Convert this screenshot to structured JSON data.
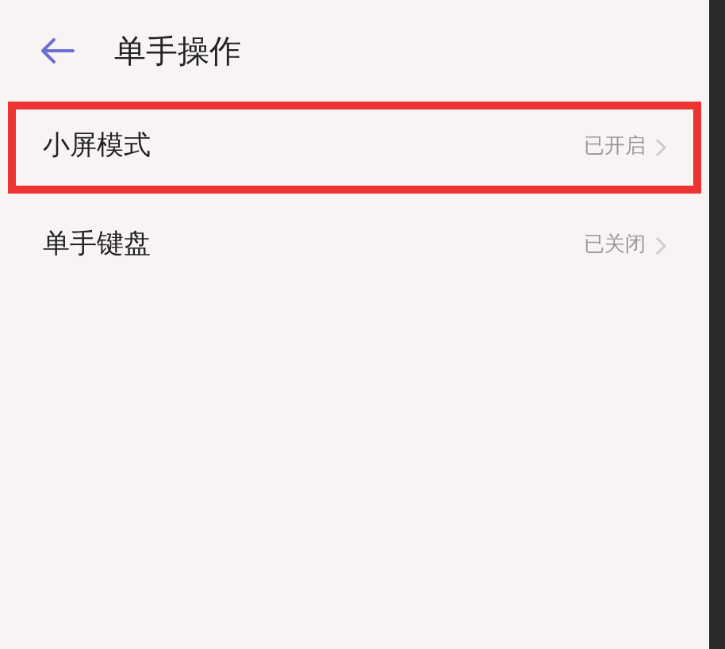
{
  "header": {
    "title": "单手操作"
  },
  "items": [
    {
      "label": "小屏模式",
      "value": "已开启",
      "highlighted": true
    },
    {
      "label": "单手键盘",
      "value": "已关闭",
      "highlighted": false
    }
  ]
}
